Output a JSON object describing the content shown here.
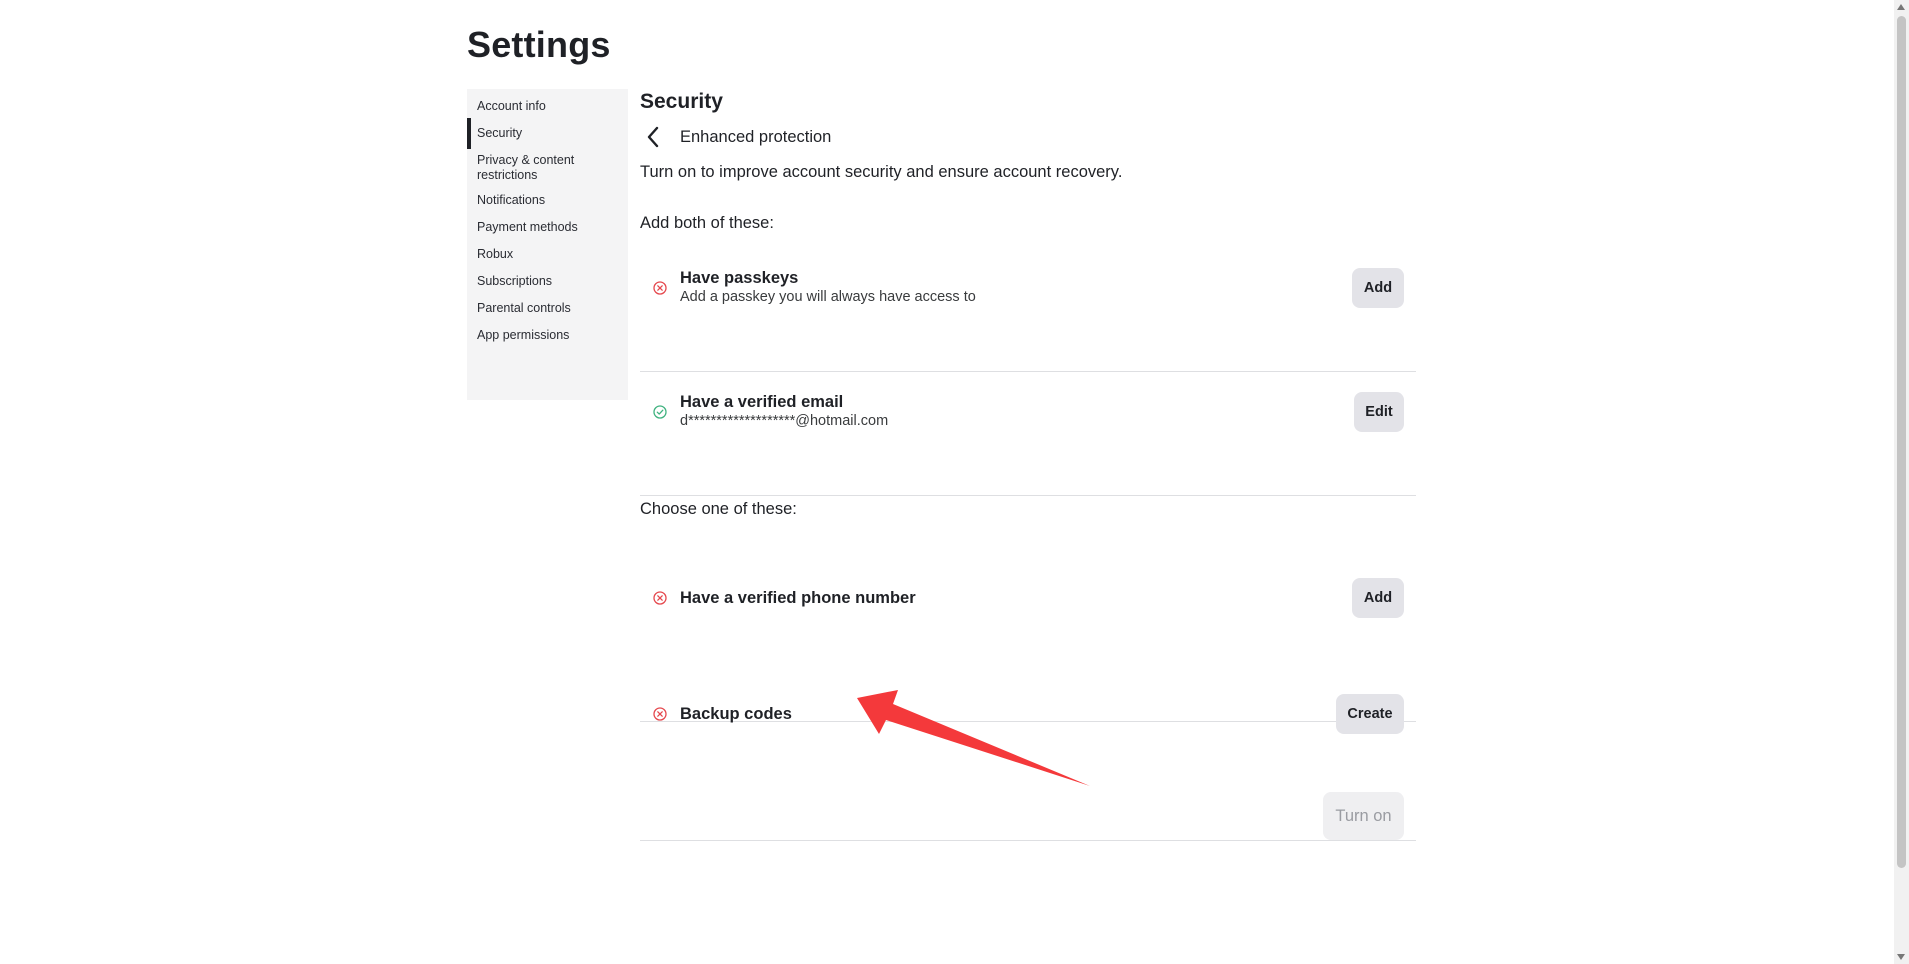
{
  "page": {
    "title": "Settings"
  },
  "sidebar": {
    "items": [
      {
        "label": "Account info",
        "active": false
      },
      {
        "label": "Security",
        "active": true
      },
      {
        "label": "Privacy & content restrictions",
        "active": false
      },
      {
        "label": "Notifications",
        "active": false
      },
      {
        "label": "Payment methods",
        "active": false
      },
      {
        "label": "Robux",
        "active": false
      },
      {
        "label": "Subscriptions",
        "active": false
      },
      {
        "label": "Parental controls",
        "active": false
      },
      {
        "label": "App permissions",
        "active": false
      }
    ]
  },
  "main": {
    "section_title": "Security",
    "back_label": "Enhanced protection",
    "intro": "Turn on to improve account security and ensure account recovery.",
    "group_required": "Add both of these:",
    "group_choose": "Choose one of these:",
    "rows": [
      {
        "title": "Have passkeys",
        "subtitle": "Add a passkey you will always have access to",
        "status": "missing",
        "button": "Add"
      },
      {
        "title": "Have a verified email",
        "subtitle": "d*******************@hotmail.com",
        "status": "done",
        "button": "Edit"
      },
      {
        "title": "Have a verified phone number",
        "subtitle": "",
        "status": "missing",
        "button": "Add"
      },
      {
        "title": "Backup codes",
        "subtitle": "",
        "status": "missing",
        "button": "Create"
      }
    ],
    "turn_on_label": "Turn on"
  },
  "colors": {
    "missing": "#e5484d",
    "done": "#3fb27f",
    "annotation_arrow": "#f4393b"
  }
}
